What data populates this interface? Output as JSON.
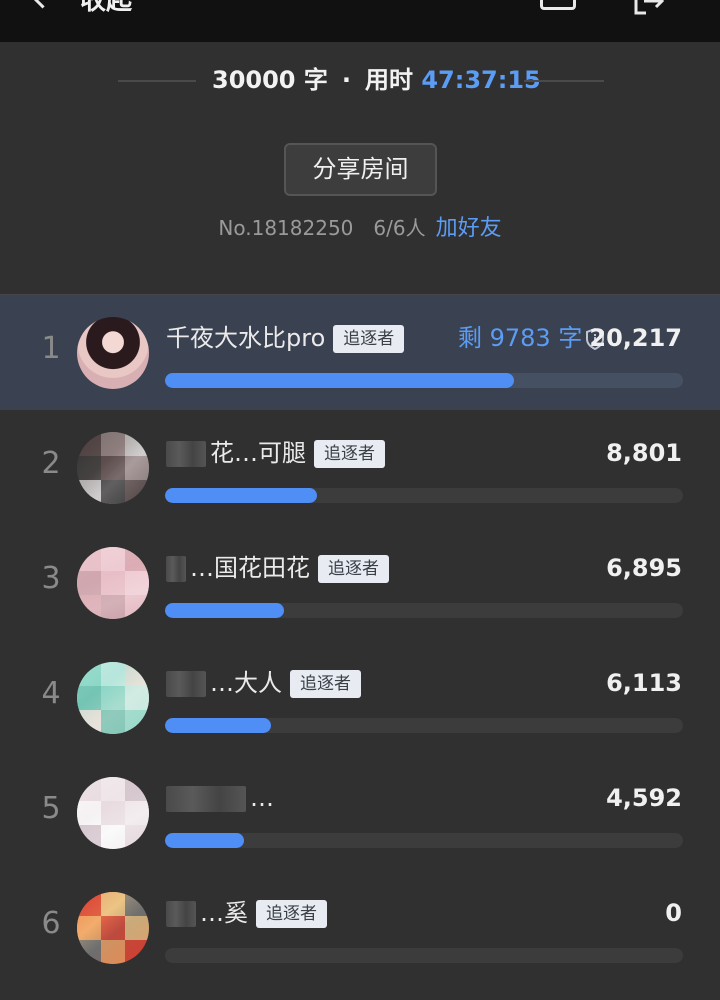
{
  "header": {
    "title": "收起"
  },
  "stats": {
    "word_count": "30000 字",
    "separator": "·",
    "time_label": "用时",
    "time_value": "47:37:15"
  },
  "share_button": "分享房间",
  "room": {
    "number": "No.18182250",
    "members": "6/6人",
    "add_friend": "加好友"
  },
  "ranking": [
    {
      "rank": "1",
      "name": "千夜大水比pro",
      "badge": "追逐者",
      "remaining": "剩 9783 字",
      "score": "20,217",
      "progress": 0.674
    },
    {
      "rank": "2",
      "name": "花…可腿",
      "badge": "追逐者",
      "remaining": "",
      "score": "8,801",
      "progress": 0.293
    },
    {
      "rank": "3",
      "name": "…国花田花",
      "badge": "追逐者",
      "remaining": "",
      "score": "6,895",
      "progress": 0.23
    },
    {
      "rank": "4",
      "name": "…大人",
      "badge": "追逐者",
      "remaining": "",
      "score": "6,113",
      "progress": 0.204
    },
    {
      "rank": "5",
      "name": "…",
      "badge": "",
      "remaining": "",
      "score": "4,592",
      "progress": 0.153
    },
    {
      "rank": "6",
      "name": "…奚",
      "badge": "追逐者",
      "remaining": "",
      "score": "0",
      "progress": 0
    }
  ],
  "colors": {
    "accent": "#5b9cf5",
    "bar": "#4f8ef5",
    "highlight_row": "#3a4150"
  }
}
